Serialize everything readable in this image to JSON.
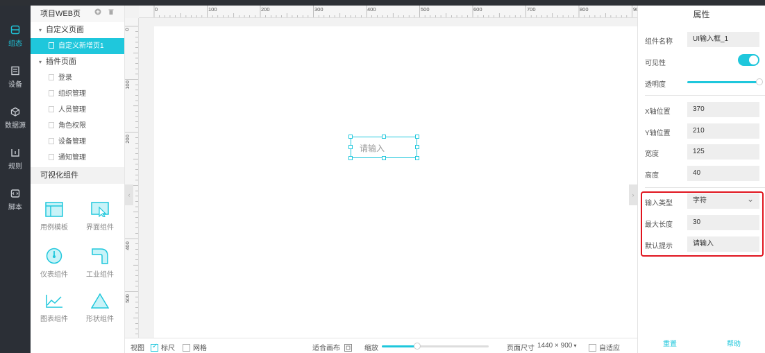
{
  "nav": [
    {
      "label": "组态",
      "icon": "layers-icon",
      "active": true
    },
    {
      "label": "设备",
      "icon": "device-icon",
      "active": false
    },
    {
      "label": "数据源",
      "icon": "cube-icon",
      "active": false
    },
    {
      "label": "规则",
      "icon": "rule-icon",
      "active": false
    },
    {
      "label": "脚本",
      "icon": "script-icon",
      "active": false
    }
  ],
  "tree": {
    "title": "项目WEB页",
    "custom_group": "自定义页面",
    "custom_pages": [
      "自定义新增页1"
    ],
    "plugin_group": "插件页面",
    "plugin_pages": [
      "登录",
      "组织管理",
      "人员管理",
      "角色权限",
      "设备管理",
      "通知管理"
    ]
  },
  "widgets": {
    "title": "可视化组件",
    "items": [
      "用例模板",
      "界面组件",
      "仪表组件",
      "工业组件",
      "图表组件",
      "形状组件"
    ]
  },
  "ruler": {
    "top": [
      "0",
      "100",
      "200",
      "300",
      "400",
      "500",
      "600",
      "700",
      "800",
      "90"
    ],
    "left": [
      "0",
      "100",
      "200",
      "400",
      "500"
    ]
  },
  "canvas_component": {
    "placeholder": "请输入"
  },
  "bottombar": {
    "view": "视图",
    "ruler_label": "标尺",
    "ruler_checked": true,
    "grid_label": "网格",
    "grid_checked": false,
    "fit_label": "适合画布",
    "zoom_label": "缩放",
    "zoom_fraction": 0.33,
    "page_size_label": "页面尺寸",
    "page_size_value": "1440 × 900",
    "adaptive_label": "自适应"
  },
  "props": {
    "title": "属性",
    "name_label": "组件名称",
    "name_value": "UI输入框_1",
    "visible_label": "可见性",
    "opacity_label": "透明度",
    "x_label": "X轴位置",
    "x_value": "370",
    "y_label": "Y轴位置",
    "y_value": "210",
    "width_label": "宽度",
    "width_value": "125",
    "height_label": "高度",
    "height_value": "40",
    "input_type_label": "输入类型",
    "input_type_value": "字符",
    "max_len_label": "最大长度",
    "max_len_value": "30",
    "default_hint_label": "默认提示",
    "default_hint_value": "请输入",
    "reset": "重置",
    "help": "帮助"
  },
  "colors": {
    "accent": "#1fc7dc",
    "highlight": "#e0141e",
    "nav_bg": "#2b2f36"
  }
}
